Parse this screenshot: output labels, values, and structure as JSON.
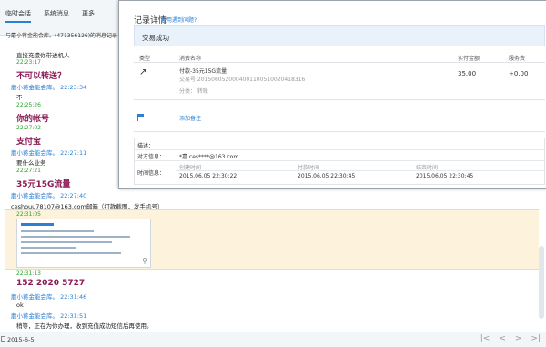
{
  "nav": {
    "tabs": [
      "临时会话",
      "系统消息",
      "更多"
    ]
  },
  "session": {
    "subtitle": "与蘑小蒋金能会库。(471356126)的消息记录"
  },
  "messages": {
    "m1": "直接充遭你带进机人",
    "t1": "22:23:17",
    "m2": "不可以转送？",
    "s2": "蘑小蒋金能会库。 22:23:34",
    "m3": "不",
    "t3": "22:25:26",
    "m4": "你的帐号",
    "t4": "22:27:02",
    "m5": "支付宝",
    "s5": "蘑小蒋金能会库。 22:27:11",
    "m6": "要什么业务",
    "t6": "22:27:21",
    "m7": "35元15G流量",
    "s7": "蘑小蒋金能会库。 22:27:40",
    "m8": "ceshouu78107@163.com邮箱（打款截图，发手机号）",
    "t8": "22:31:05",
    "t9": "22:31:13",
    "m10": "152 2020 5727",
    "s10": "蘑小蒋金能会库。 22:31:46",
    "m11": "ok",
    "s11": "蘑小蒋金能会库。 22:31:51",
    "m12": "稍等，正在为你办理，收到充值成功短信后再使用。"
  },
  "bottombar": {
    "date": "2015-6-5",
    "pager": [
      "|<",
      "<",
      ">",
      ">|"
    ]
  },
  "record": {
    "title": "记录详情",
    "help_link": "使用遇到问题?",
    "status": "交易成功",
    "headers": {
      "type": "类型",
      "name": "消费名称",
      "amount": "实付金额",
      "fee": "服务费"
    },
    "item_name": "付款-35元15G流量",
    "item_no": "交易号 2015060520004001100510020418316",
    "amount": "35.00",
    "fee": "+0.00",
    "category": "分类： 转账",
    "add_note": "添加备注",
    "desc_label": "描述：",
    "party_label": "对方信息：",
    "party_value": "*嘉 ces****@163.com",
    "time_label": "时间信息：",
    "time_cols": [
      "创建时间",
      "付款时间",
      "结束时间"
    ],
    "time_vals": [
      "2015.06.05 22:30:22",
      "2015.06.05 22:30:45",
      "2015.06.05 22:30:45"
    ]
  }
}
